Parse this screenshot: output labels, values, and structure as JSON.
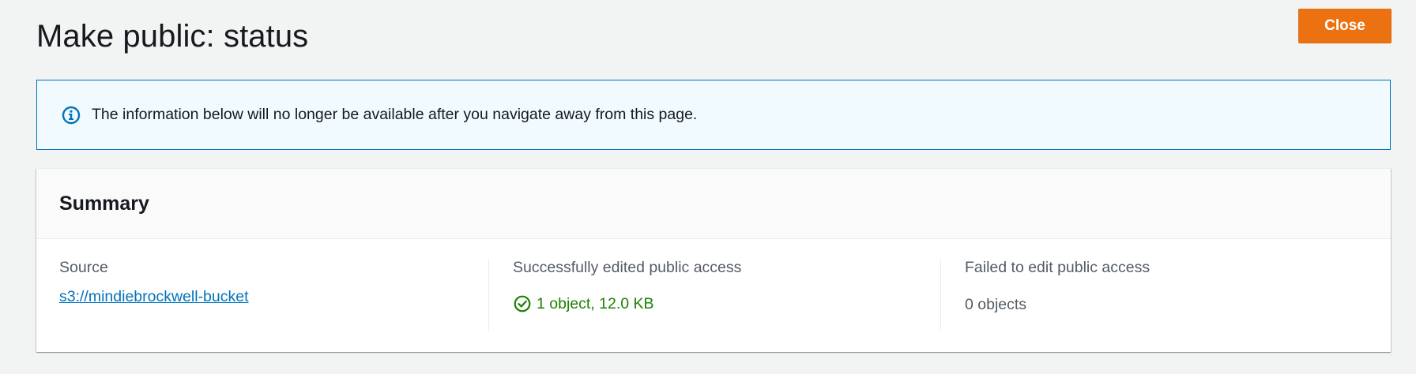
{
  "page": {
    "title": "Make public: status",
    "close_label": "Close"
  },
  "alert": {
    "icon": "info-icon",
    "message": "The information below will no longer be available after you navigate away from this page."
  },
  "summary": {
    "title": "Summary",
    "source": {
      "label": "Source",
      "link": "s3://mindiebrockwell-bucket"
    },
    "success": {
      "label": "Successfully edited public access",
      "icon": "check-circle-icon",
      "value": "1 object, 12.0 KB"
    },
    "failed": {
      "label": "Failed to edit public access",
      "value": "0 objects"
    }
  },
  "colors": {
    "background": "#f2f3f3",
    "accent_button": "#ec7211",
    "info_border": "#0073bb",
    "info_background": "#f1faff",
    "link": "#0073bb",
    "success": "#1d8102",
    "secondary_text": "#545b64"
  }
}
